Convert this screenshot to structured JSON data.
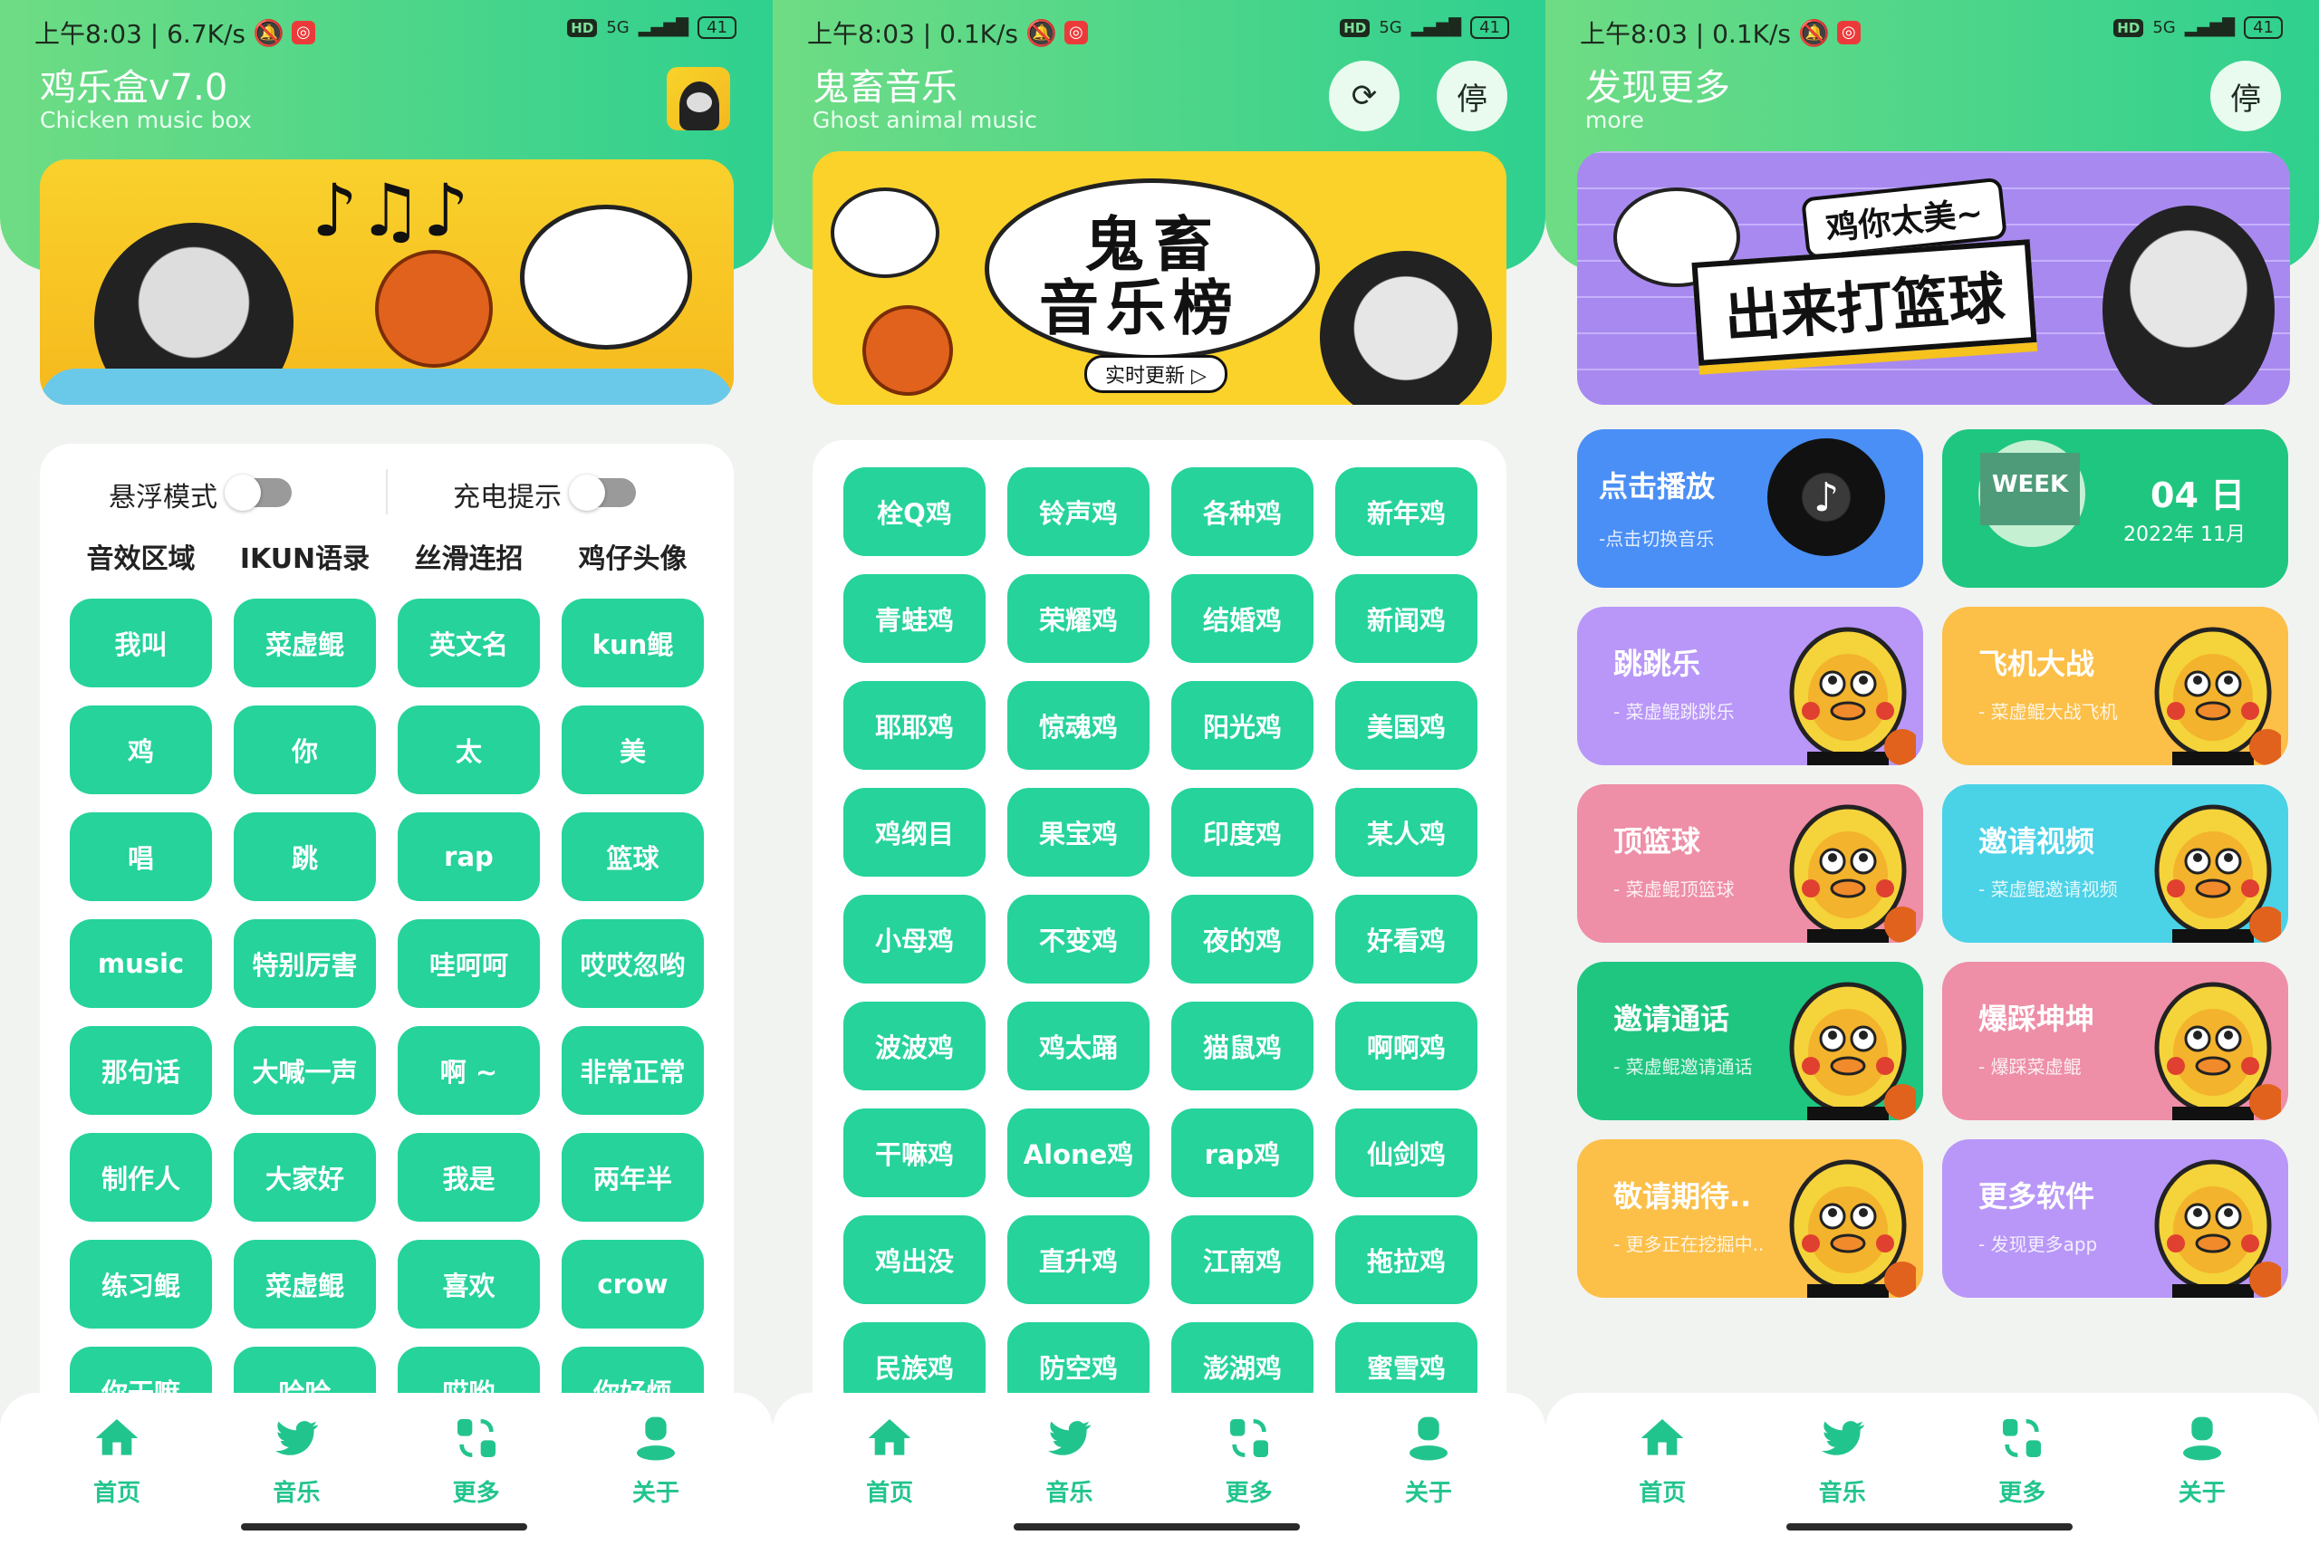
{
  "status_bars": [
    {
      "time": "上午8:03 | 6.7K/s",
      "battery": "41",
      "network": "5G"
    },
    {
      "time": "上午8:03 | 0.1K/s",
      "battery": "41",
      "network": "5G"
    },
    {
      "time": "上午8:03 | 0.1K/s",
      "battery": "41",
      "network": "5G"
    }
  ],
  "home": {
    "title": "鸡乐盒v7.0",
    "subtitle": "Chicken music box",
    "toggles": [
      {
        "label": "悬浮模式",
        "on": false
      },
      {
        "label": "充电提示",
        "on": false
      }
    ],
    "categories": [
      "音效区域",
      "IKUN语录",
      "丝滑连招",
      "鸡仔头像"
    ],
    "buttons": [
      "我叫",
      "菜虚鲲",
      "英文名",
      "kun鲲",
      "鸡",
      "你",
      "太",
      "美",
      "唱",
      "跳",
      "rap",
      "篮球",
      "music",
      "特别厉害",
      "哇呵呵",
      "哎哎忽哟",
      "那句话",
      "大喊一声",
      "啊 ~",
      "非常正常",
      "制作人",
      "大家好",
      "我是",
      "两年半",
      "练习鲲",
      "菜虚鲲",
      "喜欢",
      "crow",
      "你干嘛",
      "哈哈",
      "哎哟",
      "你好烦"
    ]
  },
  "music": {
    "title": "鬼畜音乐",
    "subtitle": "Ghost animal music",
    "refresh_icon": "refresh-icon",
    "stop_label": "停",
    "banner_title_1": "鬼畜",
    "banner_title_2": "音乐榜",
    "banner_badge": "实时更新 ▷",
    "buttons": [
      "栓Q鸡",
      "铃声鸡",
      "各种鸡",
      "新年鸡",
      "青蛙鸡",
      "荣耀鸡",
      "结婚鸡",
      "新闻鸡",
      "耶耶鸡",
      "惊魂鸡",
      "阳光鸡",
      "美国鸡",
      "鸡纲目",
      "果宝鸡",
      "印度鸡",
      "某人鸡",
      "小母鸡",
      "不变鸡",
      "夜的鸡",
      "好看鸡",
      "波波鸡",
      "鸡太踊",
      "猫鼠鸡",
      "啊啊鸡",
      "干嘛鸡",
      "Alone鸡",
      "rap鸡",
      "仙剑鸡",
      "鸡出没",
      "直升鸡",
      "江南鸡",
      "拖拉鸡",
      "民族鸡",
      "防空鸡",
      "澎湖鸡",
      "蜜雪鸡"
    ]
  },
  "more": {
    "title": "发现更多",
    "subtitle": "more",
    "stop_label": "停",
    "banner_tag": "鸡你太美~",
    "banner_title": "出来打篮球",
    "play_tile": {
      "title": "点击播放",
      "subtitle": "-点击切换音乐",
      "color": "#4a8ff6"
    },
    "date_tile": {
      "week": "WEEK",
      "day": "04 日",
      "month": "2022年 11月",
      "color": "#1fc680"
    },
    "tiles": [
      {
        "title": "跳跳乐",
        "subtitle": "- 菜虚鲲跳跳乐",
        "color": "#b897f8"
      },
      {
        "title": "飞机大战",
        "subtitle": "- 菜虚鲲大战飞机",
        "color": "#fcbf48"
      },
      {
        "title": "顶篮球",
        "subtitle": "- 菜虚鲲顶篮球",
        "color": "#ee8ea7"
      },
      {
        "title": "邀请视频",
        "subtitle": "- 菜虚鲲邀请视频",
        "color": "#4ad2e7"
      },
      {
        "title": "邀请通话",
        "subtitle": "- 菜虚鲲邀请通话",
        "color": "#1fc680"
      },
      {
        "title": "爆踩坤坤",
        "subtitle": "- 爆踩菜虚鲲",
        "color": "#ee8ea7"
      },
      {
        "title": "敬请期待..",
        "subtitle": "- 更多正在挖掘中..",
        "color": "#fcbf48"
      },
      {
        "title": "更多软件",
        "subtitle": "- 发现更多app",
        "color": "#b897f8"
      }
    ]
  },
  "nav": [
    {
      "label": "首页",
      "icon": "home-icon"
    },
    {
      "label": "音乐",
      "icon": "bird-icon"
    },
    {
      "label": "更多",
      "icon": "swap-icon"
    },
    {
      "label": "关于",
      "icon": "user-icon"
    }
  ],
  "colors": {
    "accent": "#25d39b",
    "nav": "#22c48d",
    "header_start": "#6fdc84",
    "header_end": "#2fd08f"
  }
}
